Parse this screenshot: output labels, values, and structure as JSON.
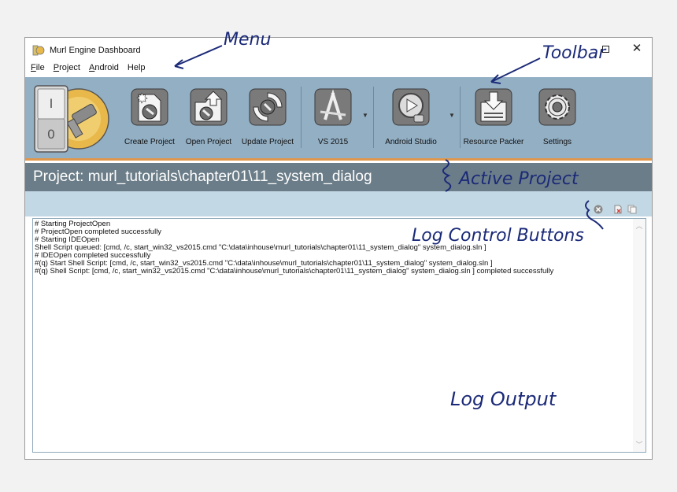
{
  "window": {
    "title": "Murl Engine Dashboard"
  },
  "menu": [
    {
      "underline": "F",
      "rest": "ile"
    },
    {
      "underline": "P",
      "rest": "roject"
    },
    {
      "underline": "A",
      "rest": "ndroid"
    },
    {
      "underline": "",
      "rest": "Help"
    }
  ],
  "toolbar": {
    "buttons": [
      {
        "label": "Create Project",
        "icon": "create-project-icon"
      },
      {
        "label": "Open Project",
        "icon": "open-project-icon"
      },
      {
        "label": "Update Project",
        "icon": "update-project-icon"
      },
      {
        "label": "VS 2015",
        "icon": "vs2015-icon"
      },
      {
        "label": "Android Studio",
        "icon": "android-studio-icon"
      },
      {
        "label": "Resource Packer",
        "icon": "resource-packer-icon"
      },
      {
        "label": "Settings",
        "icon": "settings-icon"
      }
    ],
    "logo_switch": {
      "top": "I",
      "bottom": "0"
    }
  },
  "project": {
    "label": "Project: murl_tutorials\\chapter01\\11_system_dialog"
  },
  "log": {
    "lines": [
      "# Starting ProjectOpen",
      "# ProjectOpen completed successfully",
      "# Starting IDEOpen",
      "Shell Script queued: [cmd, /c, start_win32_vs2015.cmd \"C:\\data\\inhouse\\murl_tutorials\\chapter01\\11_system_dialog\" system_dialog.sln ]",
      "# IDEOpen completed successfully",
      "#(q) Start Shell Script: [cmd, /c, start_win32_vs2015.cmd \"C:\\data\\inhouse\\murl_tutorials\\chapter01\\11_system_dialog\" system_dialog.sln ]",
      "#(q) Shell Script: [cmd, /c, start_win32_vs2015.cmd \"C:\\data\\inhouse\\murl_tutorials\\chapter01\\11_system_dialog\" system_dialog.sln ] completed successfully"
    ]
  },
  "annotations": {
    "menu": "Menu",
    "toolbar": "Toolbar",
    "active_project": "Active Project",
    "log_controls": "Log Control Buttons",
    "log_output": "Log Output"
  },
  "colors": {
    "toolbar_bg": "#93afc4",
    "toolbar_accent": "#e0974b",
    "project_bar_bg": "#6b7d88",
    "log_controls_bg": "#c2d8e4",
    "annotation_ink": "#1b2a78"
  }
}
